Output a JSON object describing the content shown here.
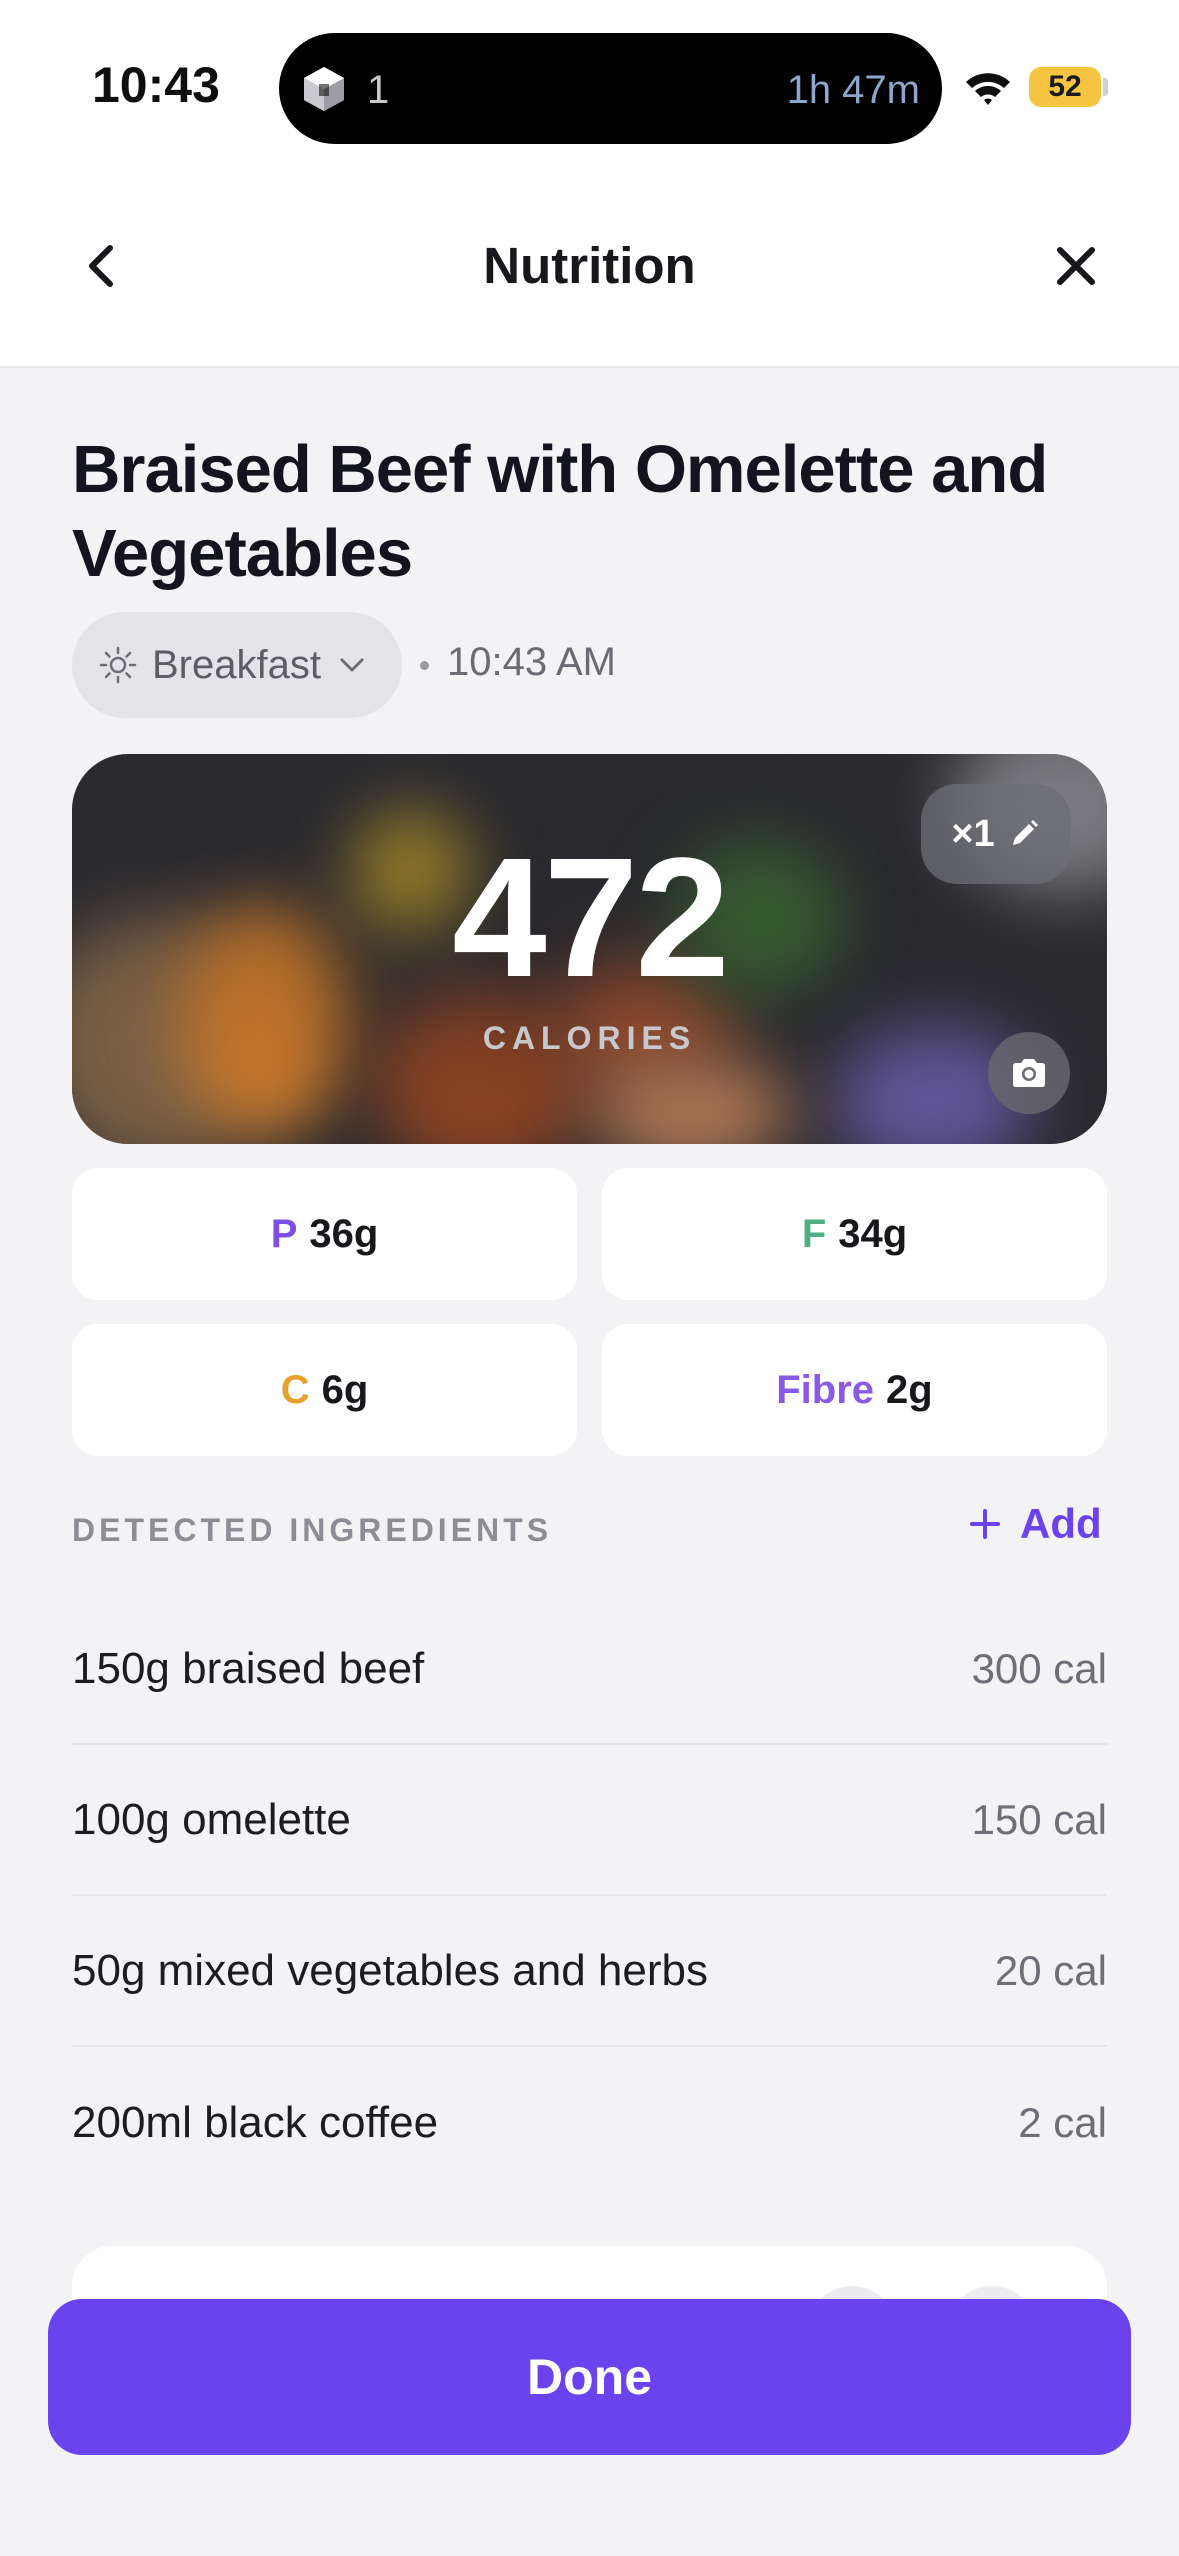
{
  "status_bar": {
    "time": "10:43",
    "island_count": "1",
    "island_timer": "1h 47m",
    "battery": "52"
  },
  "header": {
    "title": "Nutrition"
  },
  "meal": {
    "title": "Braised Beef with Omelette and Vegetables",
    "type": "Breakfast",
    "time": "10:43 AM"
  },
  "calories": {
    "value": "472",
    "label": "CALORIES",
    "servings": "×1"
  },
  "macros": [
    {
      "letter": "P",
      "value": "36g",
      "color": "#7b4fe8"
    },
    {
      "letter": "F",
      "value": "34g",
      "color": "#4fae84"
    },
    {
      "letter": "C",
      "value": "6g",
      "color": "#e4a22d"
    },
    {
      "letter": "Fibre",
      "value": "2g",
      "color": "#8a5ae6"
    }
  ],
  "ingredients": {
    "label": "DETECTED INGREDIENTS",
    "add_label": "Add",
    "items": [
      {
        "name": "150g braised beef",
        "calories": "300 cal"
      },
      {
        "name": "100g omelette",
        "calories": "150 cal"
      },
      {
        "name": "50g mixed vegetables and herbs",
        "calories": "20 cal"
      },
      {
        "name": "200ml black coffee",
        "calories": "2 cal"
      }
    ]
  },
  "actions": {
    "done_label": "Done"
  },
  "icons": {
    "back": "chevron-left-icon",
    "close": "close-icon",
    "meal_type": "sun-icon",
    "dropdown": "chevron-down-icon",
    "edit": "pencil-icon",
    "photo": "camera-icon",
    "add": "plus-icon"
  },
  "colors": {
    "accent": "#6a42ee",
    "background": "#f3f3f6",
    "battery": "#f5c542"
  }
}
